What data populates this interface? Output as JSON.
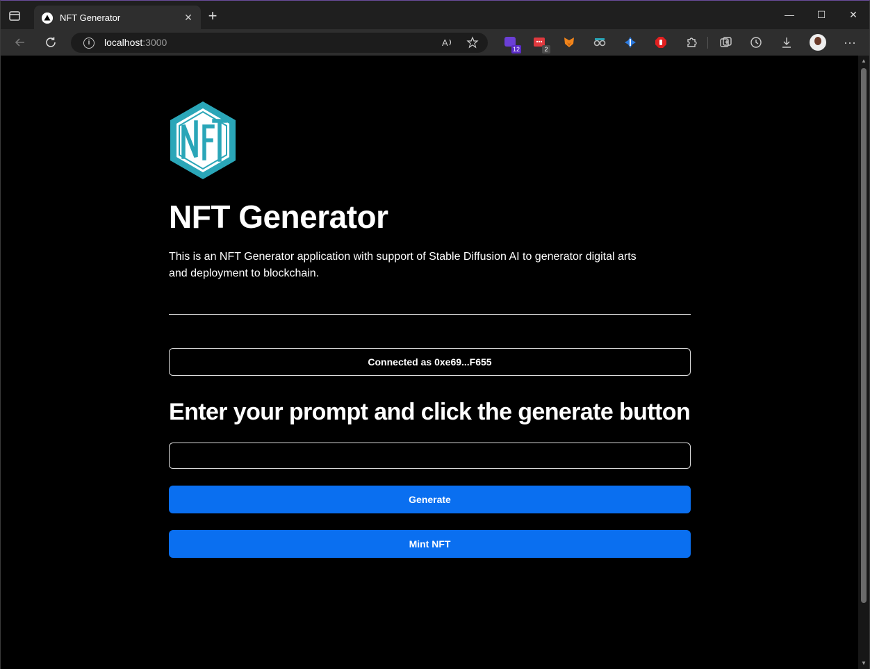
{
  "browser": {
    "tab": {
      "title": "NFT Generator",
      "close_glyph": "✕"
    },
    "new_tab_glyph": "+",
    "window_controls": {
      "minimize": "—",
      "maximize": "☐",
      "close": "✕"
    },
    "address": {
      "host": "localhost",
      "port": ":3000"
    },
    "extensions": [
      {
        "name": "ext-purple-icon",
        "badge": "12",
        "color": "#6b3fd6",
        "badge_color": "#5a2bc7"
      },
      {
        "name": "ext-red-icon",
        "badge": "2",
        "color": "#e0393e",
        "badge_color": "#4a4a4a"
      },
      {
        "name": "metamask-fox-icon",
        "badge": "",
        "color": "#f0841b",
        "badge_color": ""
      },
      {
        "name": "ext-glasses-icon",
        "badge": "",
        "color": "#4a4a4a",
        "badge_color": ""
      },
      {
        "name": "ext-blue-cross-icon",
        "badge": "",
        "color": "#2c7be0",
        "badge_color": ""
      },
      {
        "name": "adblock-hand-icon",
        "badge": "",
        "color": "#e02020",
        "badge_color": ""
      }
    ],
    "more_glyph": "···"
  },
  "page": {
    "logo_text": "NFT",
    "title": "NFT Generator",
    "description": "This is an NFT Generator application with support of Stable Diffusion AI to generator digital arts and deployment to blockchain.",
    "connected_label": "Connected as 0xe69...F655",
    "prompt_heading": "Enter your prompt and click the generate button",
    "prompt_value": "",
    "generate_label": "Generate",
    "mint_label": "Mint NFT"
  },
  "colors": {
    "accent": "#0a6ff0",
    "logo_teal": "#2aa6b8"
  }
}
